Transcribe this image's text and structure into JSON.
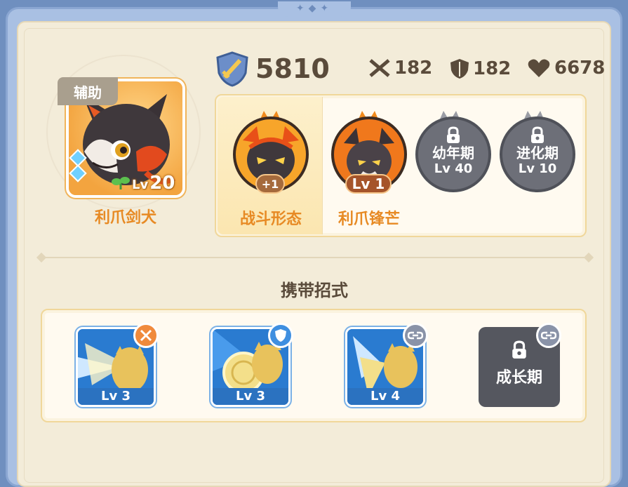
{
  "pet": {
    "role": "辅助",
    "level_prefix": "Lv",
    "level": "20",
    "name": "利爪剑犬"
  },
  "stats": {
    "power": "5810",
    "attack": "182",
    "defense": "182",
    "hp": "6678"
  },
  "forms": [
    {
      "label": "战斗形态",
      "badge": "+1",
      "selected": true
    },
    {
      "label": "利爪锋芒",
      "badge": "Lv 1",
      "selected": false
    }
  ],
  "locked_stages": [
    {
      "name": "幼年期",
      "level": "Lv 40"
    },
    {
      "name": "进化期",
      "level": "Lv 10"
    }
  ],
  "moves_section": {
    "title": "携带招式",
    "moves": [
      {
        "level": "Lv 3",
        "badge_icon": "attack-cancel-icon",
        "badge_color": "#f08a3c"
      },
      {
        "level": "Lv 3",
        "badge_icon": "shield-icon",
        "badge_color": "#3f8fe0"
      },
      {
        "level": "Lv 4",
        "badge_icon": "link-icon",
        "badge_color": "#8a93a8"
      }
    ],
    "locked_move": {
      "label": "成长期",
      "badge_icon": "link-icon"
    }
  },
  "colors": {
    "accent_orange": "#e78a24",
    "text_brown": "#5a4b3b",
    "panel_bg": "#f3ecd9",
    "frame_blue": "#a9c0e3"
  }
}
